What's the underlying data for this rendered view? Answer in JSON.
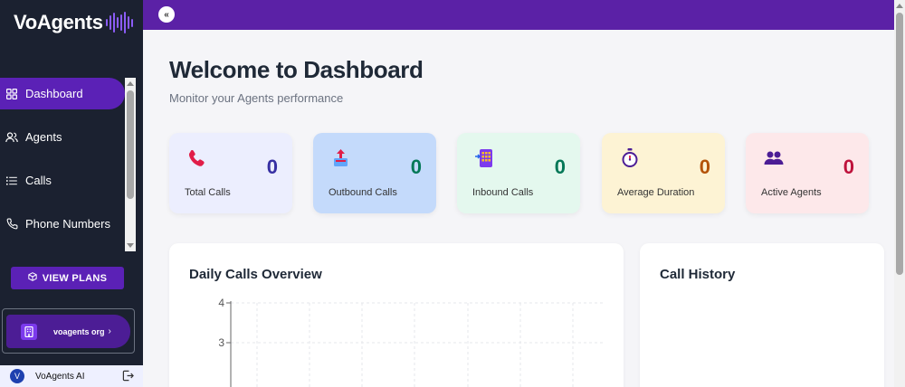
{
  "brand": {
    "name": "VoAgents",
    "accent": "#8b5cf6"
  },
  "sidebar": {
    "items": [
      {
        "label": "Dashboard",
        "icon": "grid-icon",
        "active": true
      },
      {
        "label": "Agents",
        "icon": "users-icon",
        "active": false
      },
      {
        "label": "Calls",
        "icon": "list-icon",
        "active": false
      },
      {
        "label": "Phone Numbers",
        "icon": "phone-icon",
        "active": false
      }
    ],
    "plans_label": "VIEW PLANS",
    "org_label": "voagents org",
    "user": {
      "initial": "V",
      "name": "VoAgents AI"
    }
  },
  "topbar": {
    "collapse_glyph": "«"
  },
  "main": {
    "title": "Welcome to Dashboard",
    "subtitle": "Monitor your Agents performance",
    "stats": [
      {
        "label": "Total Calls",
        "value": "0",
        "icon": "phone-handset-icon",
        "bg": "#eceefe",
        "color": "#3730a3"
      },
      {
        "label": "Outbound Calls",
        "value": "0",
        "icon": "outbound-upload-icon",
        "bg": "#c4dafb",
        "color": "#047857"
      },
      {
        "label": "Inbound Calls",
        "value": "0",
        "icon": "mobile-keypad-icon",
        "bg": "#e4f8ee",
        "color": "#047857"
      },
      {
        "label": "Average Duration",
        "value": "0",
        "icon": "stopwatch-icon",
        "bg": "#fdf3d4",
        "color": "#b45309"
      },
      {
        "label": "Active Agents",
        "value": "0",
        "icon": "people-icon",
        "bg": "#fde8ea",
        "color": "#be123c"
      }
    ],
    "daily_title": "Daily Calls Overview",
    "history_title": "Call History"
  },
  "chart_data": {
    "type": "line",
    "title": "Daily Calls Overview",
    "xlabel": "",
    "ylabel": "",
    "y_ticks_visible": [
      4,
      3
    ],
    "series": [],
    "grid": true
  }
}
